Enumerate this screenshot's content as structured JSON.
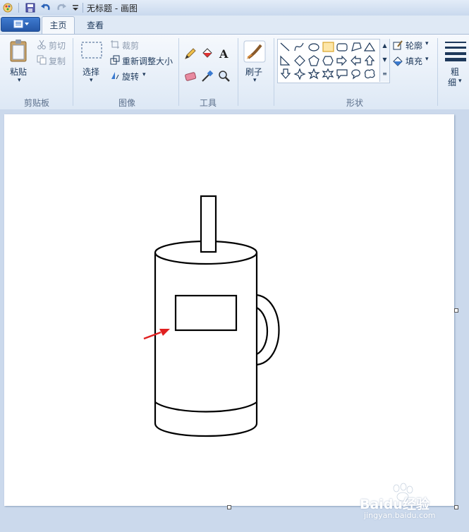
{
  "window": {
    "title": "无标题 - 画图"
  },
  "tabs": {
    "file_icon": "menu-icon",
    "home": "主页",
    "view": "查看"
  },
  "clipboard": {
    "paste": "粘贴",
    "cut": "剪切",
    "copy": "复制",
    "group": "剪贴板"
  },
  "image": {
    "select": "选择",
    "crop": "裁剪",
    "resize": "重新调整大小",
    "rotate": "旋转",
    "group": "图像"
  },
  "tools": {
    "group": "工具",
    "items": [
      "pencil-icon",
      "fill-icon",
      "text-icon",
      "eraser-icon",
      "color-picker-icon",
      "magnifier-icon"
    ]
  },
  "brushes": {
    "label": "刷子"
  },
  "shapes": {
    "group": "形状",
    "outline": "轮廓",
    "fill": "填充"
  },
  "size": {
    "label_line1": "粗",
    "label_line2": "细"
  },
  "watermark": {
    "text": "Baidu经验",
    "url": "jingyan.baidu.com"
  }
}
